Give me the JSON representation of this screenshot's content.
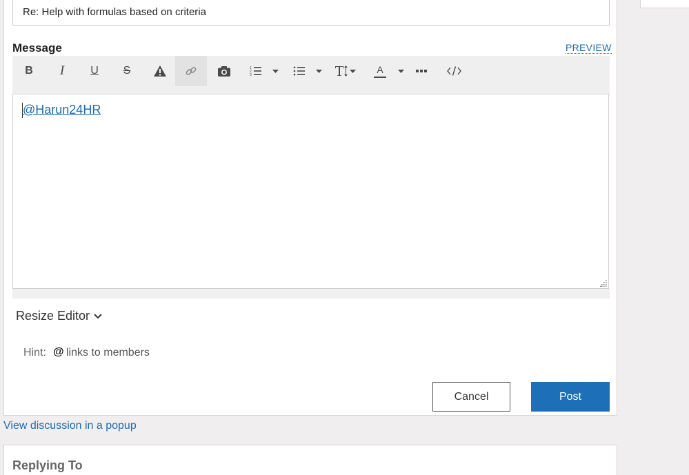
{
  "subject": {
    "value": "Re: Help with formulas based on criteria"
  },
  "message": {
    "label": "Message",
    "preview_label": "PREVIEW"
  },
  "toolbar": {
    "bold": "B",
    "italic": "I",
    "underline": "U",
    "strike": "S",
    "font_size": "T",
    "font_color": "A"
  },
  "editor": {
    "mention": "@Harun24HR"
  },
  "resize": {
    "label": "Resize Editor"
  },
  "hint": {
    "prefix": "Hint:",
    "symbol": "@",
    "text": "links to members"
  },
  "actions": {
    "cancel": "Cancel",
    "post": "Post"
  },
  "discussion": {
    "popup_link": "View discussion in a popup"
  },
  "replying": {
    "title": "Replying To"
  },
  "colors": {
    "accent": "#1d6fb8",
    "link": "#1a6bb3",
    "background": "#f0eeef"
  }
}
